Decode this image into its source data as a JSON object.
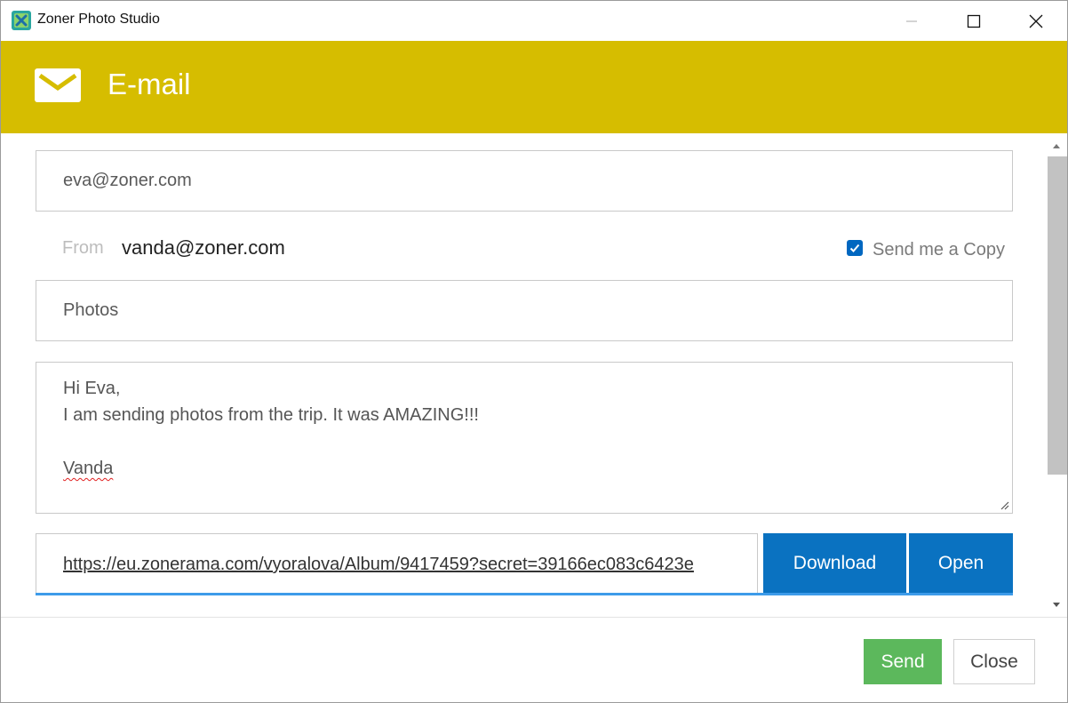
{
  "window": {
    "title": "Zoner Photo Studio"
  },
  "header": {
    "title": "E-mail",
    "color": "#d6bd00"
  },
  "form": {
    "to_value": "eva@zoner.com",
    "from_label": "From",
    "from_value": "vanda@zoner.com",
    "send_copy_label": "Send me a Copy",
    "send_copy_checked": true,
    "subject_value": "Photos",
    "body_lines": [
      "Hi Eva,",
      "I am sending photos from the trip. It was AMAZING!!!",
      "",
      "Vanda"
    ],
    "link_value": "https://eu.zonerama.com/vyoralova/Album/9417459?secret=39166ec083c6423e"
  },
  "link_actions": {
    "download_label": "Download",
    "open_label": "Open",
    "color": "#0a72c1"
  },
  "footer": {
    "send_label": "Send",
    "close_label": "Close",
    "send_color": "#5cb85c"
  }
}
